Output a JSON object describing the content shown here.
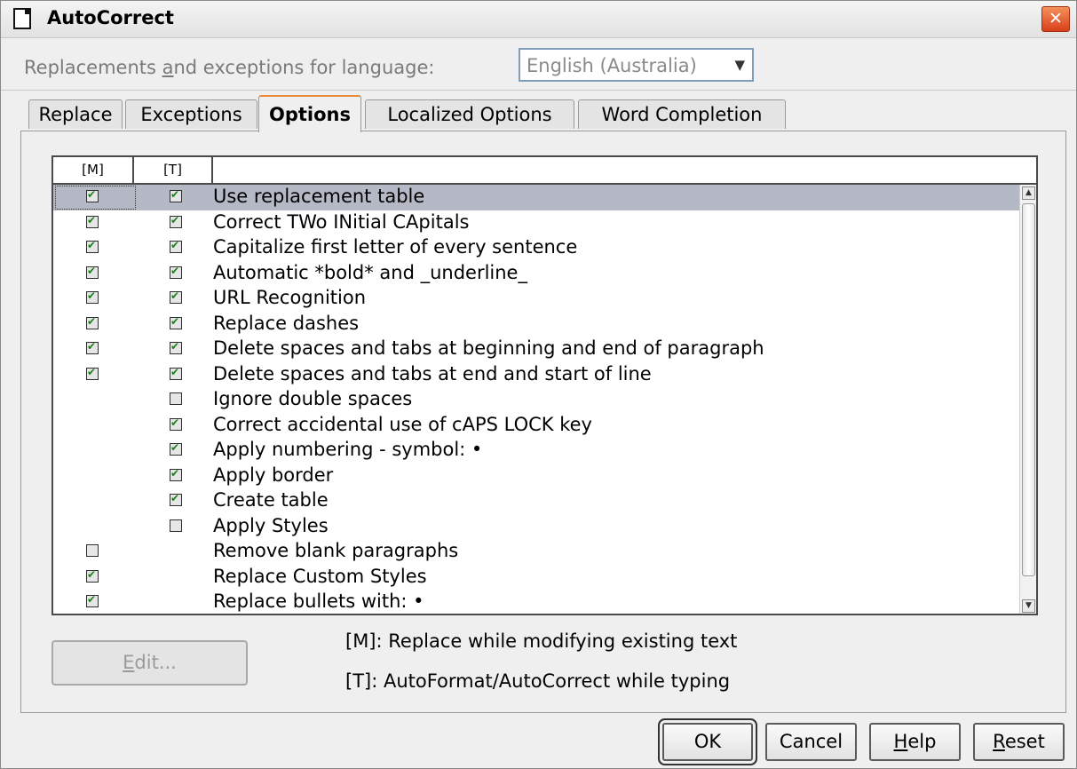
{
  "window": {
    "title": "AutoCorrect",
    "icons": {
      "app": "document-icon",
      "close": "close-icon"
    }
  },
  "language": {
    "label_pre": "Replacements ",
    "label_u": "a",
    "label_post": "nd exceptions for language:",
    "selected": "English (Australia)"
  },
  "tabs": [
    {
      "label": "Replace",
      "active": false
    },
    {
      "label": "Exceptions",
      "active": false
    },
    {
      "label": "Options",
      "active": true
    },
    {
      "label": "Localized Options",
      "active": false
    },
    {
      "label": "Word Completion",
      "active": false
    }
  ],
  "options_list": {
    "col_m": "[M]",
    "col_t": "[T]",
    "rows": [
      {
        "label": "Use replacement table",
        "m": true,
        "t": true,
        "selected": true
      },
      {
        "label": "Correct TWo INitial CApitals",
        "m": true,
        "t": true
      },
      {
        "label": "Capitalize first letter of every sentence",
        "m": true,
        "t": true
      },
      {
        "label": "Automatic *bold* and _underline_",
        "m": true,
        "t": true
      },
      {
        "label": "URL Recognition",
        "m": true,
        "t": true
      },
      {
        "label": "Replace dashes",
        "m": true,
        "t": true
      },
      {
        "label": "Delete spaces and tabs at beginning and end of paragraph",
        "m": true,
        "t": true
      },
      {
        "label": "Delete spaces and tabs at end and start of line",
        "m": true,
        "t": true
      },
      {
        "label": "Ignore double spaces",
        "m": null,
        "t": false
      },
      {
        "label": "Correct accidental use of cAPS LOCK key",
        "m": null,
        "t": true
      },
      {
        "label": "Apply numbering - symbol: •",
        "m": null,
        "t": true
      },
      {
        "label": "Apply border",
        "m": null,
        "t": true
      },
      {
        "label": "Create table",
        "m": null,
        "t": true
      },
      {
        "label": "Apply Styles",
        "m": null,
        "t": false
      },
      {
        "label": "Remove blank paragraphs",
        "m": false,
        "t": null
      },
      {
        "label": "Replace Custom Styles",
        "m": true,
        "t": null
      },
      {
        "label": "Replace bullets with: •",
        "m": true,
        "t": null
      }
    ]
  },
  "edit_button": {
    "label_u": "E",
    "label_rest": "dit..."
  },
  "legend": {
    "m": "[M]: Replace while modifying existing text",
    "t": "[T]: AutoFormat/AutoCorrect while typing"
  },
  "buttons": {
    "ok": "OK",
    "cancel": "Cancel",
    "help_u": "H",
    "help_rest": "elp",
    "reset_u": "R",
    "reset_rest": "eset"
  }
}
